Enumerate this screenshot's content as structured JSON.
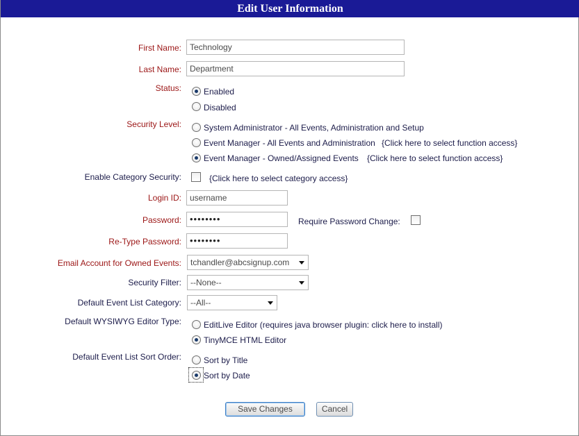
{
  "title": "Edit User Information",
  "fields": {
    "first_name": {
      "label": "First Name:",
      "value": "Technology"
    },
    "last_name": {
      "label": "Last Name:",
      "value": "Department"
    },
    "status": {
      "label": "Status:",
      "options": [
        {
          "label": "Enabled",
          "selected": true
        },
        {
          "label": "Disabled",
          "selected": false
        }
      ]
    },
    "security_level": {
      "label": "Security Level:",
      "options": [
        {
          "label": "System Administrator - All Events, Administration and Setup",
          "selected": false,
          "link": ""
        },
        {
          "label": "Event Manager - All Events and Administration",
          "selected": false,
          "link": "{Click here to select function access}"
        },
        {
          "label": "Event Manager - Owned/Assigned Events",
          "selected": true,
          "link": "{Click here to select function access}"
        }
      ]
    },
    "category_security": {
      "label": "Enable Category Security:",
      "checked": false,
      "link": "{Click here to select category access}"
    },
    "login_id": {
      "label": "Login ID:",
      "value": "username"
    },
    "password": {
      "label": "Password:",
      "value": "••••••••"
    },
    "require_password_change": {
      "label": "Require Password Change:",
      "checked": false
    },
    "retype_password": {
      "label": "Re-Type Password:",
      "value": "••••••••"
    },
    "email_account": {
      "label": "Email Account for Owned Events:",
      "value": "tchandler@abcsignup.com"
    },
    "security_filter": {
      "label": "Security Filter:",
      "value": "--None--"
    },
    "default_category": {
      "label": "Default Event List Category:",
      "value": "--All--"
    },
    "editor_type": {
      "label": "Default WYSIWYG Editor Type:",
      "options": [
        {
          "label": "EditLive Editor (requires java browser plugin: click here to install)",
          "selected": false
        },
        {
          "label": "TinyMCE HTML Editor",
          "selected": true
        }
      ]
    },
    "sort_order": {
      "label": "Default Event List Sort Order:",
      "options": [
        {
          "label": "Sort by Title",
          "selected": false
        },
        {
          "label": "Sort by Date",
          "selected": true
        }
      ]
    }
  },
  "buttons": {
    "save": "Save Changes",
    "cancel": "Cancel"
  },
  "colors": {
    "title_bar": "#1a1a96",
    "required_label": "#9b1515",
    "label": "#1c1c4a"
  }
}
